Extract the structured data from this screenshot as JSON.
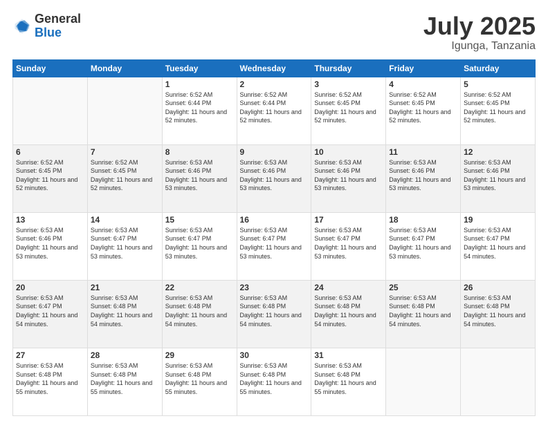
{
  "header": {
    "logo_general": "General",
    "logo_blue": "Blue",
    "month_title": "July 2025",
    "location": "Igunga, Tanzania"
  },
  "weekdays": [
    "Sunday",
    "Monday",
    "Tuesday",
    "Wednesday",
    "Thursday",
    "Friday",
    "Saturday"
  ],
  "weeks": [
    [
      {
        "day": "",
        "info": ""
      },
      {
        "day": "",
        "info": ""
      },
      {
        "day": "1",
        "info": "Sunrise: 6:52 AM\nSunset: 6:44 PM\nDaylight: 11 hours and 52 minutes."
      },
      {
        "day": "2",
        "info": "Sunrise: 6:52 AM\nSunset: 6:44 PM\nDaylight: 11 hours and 52 minutes."
      },
      {
        "day": "3",
        "info": "Sunrise: 6:52 AM\nSunset: 6:45 PM\nDaylight: 11 hours and 52 minutes."
      },
      {
        "day": "4",
        "info": "Sunrise: 6:52 AM\nSunset: 6:45 PM\nDaylight: 11 hours and 52 minutes."
      },
      {
        "day": "5",
        "info": "Sunrise: 6:52 AM\nSunset: 6:45 PM\nDaylight: 11 hours and 52 minutes."
      }
    ],
    [
      {
        "day": "6",
        "info": "Sunrise: 6:52 AM\nSunset: 6:45 PM\nDaylight: 11 hours and 52 minutes."
      },
      {
        "day": "7",
        "info": "Sunrise: 6:52 AM\nSunset: 6:45 PM\nDaylight: 11 hours and 52 minutes."
      },
      {
        "day": "8",
        "info": "Sunrise: 6:53 AM\nSunset: 6:46 PM\nDaylight: 11 hours and 53 minutes."
      },
      {
        "day": "9",
        "info": "Sunrise: 6:53 AM\nSunset: 6:46 PM\nDaylight: 11 hours and 53 minutes."
      },
      {
        "day": "10",
        "info": "Sunrise: 6:53 AM\nSunset: 6:46 PM\nDaylight: 11 hours and 53 minutes."
      },
      {
        "day": "11",
        "info": "Sunrise: 6:53 AM\nSunset: 6:46 PM\nDaylight: 11 hours and 53 minutes."
      },
      {
        "day": "12",
        "info": "Sunrise: 6:53 AM\nSunset: 6:46 PM\nDaylight: 11 hours and 53 minutes."
      }
    ],
    [
      {
        "day": "13",
        "info": "Sunrise: 6:53 AM\nSunset: 6:46 PM\nDaylight: 11 hours and 53 minutes."
      },
      {
        "day": "14",
        "info": "Sunrise: 6:53 AM\nSunset: 6:47 PM\nDaylight: 11 hours and 53 minutes."
      },
      {
        "day": "15",
        "info": "Sunrise: 6:53 AM\nSunset: 6:47 PM\nDaylight: 11 hours and 53 minutes."
      },
      {
        "day": "16",
        "info": "Sunrise: 6:53 AM\nSunset: 6:47 PM\nDaylight: 11 hours and 53 minutes."
      },
      {
        "day": "17",
        "info": "Sunrise: 6:53 AM\nSunset: 6:47 PM\nDaylight: 11 hours and 53 minutes."
      },
      {
        "day": "18",
        "info": "Sunrise: 6:53 AM\nSunset: 6:47 PM\nDaylight: 11 hours and 53 minutes."
      },
      {
        "day": "19",
        "info": "Sunrise: 6:53 AM\nSunset: 6:47 PM\nDaylight: 11 hours and 54 minutes."
      }
    ],
    [
      {
        "day": "20",
        "info": "Sunrise: 6:53 AM\nSunset: 6:47 PM\nDaylight: 11 hours and 54 minutes."
      },
      {
        "day": "21",
        "info": "Sunrise: 6:53 AM\nSunset: 6:48 PM\nDaylight: 11 hours and 54 minutes."
      },
      {
        "day": "22",
        "info": "Sunrise: 6:53 AM\nSunset: 6:48 PM\nDaylight: 11 hours and 54 minutes."
      },
      {
        "day": "23",
        "info": "Sunrise: 6:53 AM\nSunset: 6:48 PM\nDaylight: 11 hours and 54 minutes."
      },
      {
        "day": "24",
        "info": "Sunrise: 6:53 AM\nSunset: 6:48 PM\nDaylight: 11 hours and 54 minutes."
      },
      {
        "day": "25",
        "info": "Sunrise: 6:53 AM\nSunset: 6:48 PM\nDaylight: 11 hours and 54 minutes."
      },
      {
        "day": "26",
        "info": "Sunrise: 6:53 AM\nSunset: 6:48 PM\nDaylight: 11 hours and 54 minutes."
      }
    ],
    [
      {
        "day": "27",
        "info": "Sunrise: 6:53 AM\nSunset: 6:48 PM\nDaylight: 11 hours and 55 minutes."
      },
      {
        "day": "28",
        "info": "Sunrise: 6:53 AM\nSunset: 6:48 PM\nDaylight: 11 hours and 55 minutes."
      },
      {
        "day": "29",
        "info": "Sunrise: 6:53 AM\nSunset: 6:48 PM\nDaylight: 11 hours and 55 minutes."
      },
      {
        "day": "30",
        "info": "Sunrise: 6:53 AM\nSunset: 6:48 PM\nDaylight: 11 hours and 55 minutes."
      },
      {
        "day": "31",
        "info": "Sunrise: 6:53 AM\nSunset: 6:48 PM\nDaylight: 11 hours and 55 minutes."
      },
      {
        "day": "",
        "info": ""
      },
      {
        "day": "",
        "info": ""
      }
    ]
  ]
}
